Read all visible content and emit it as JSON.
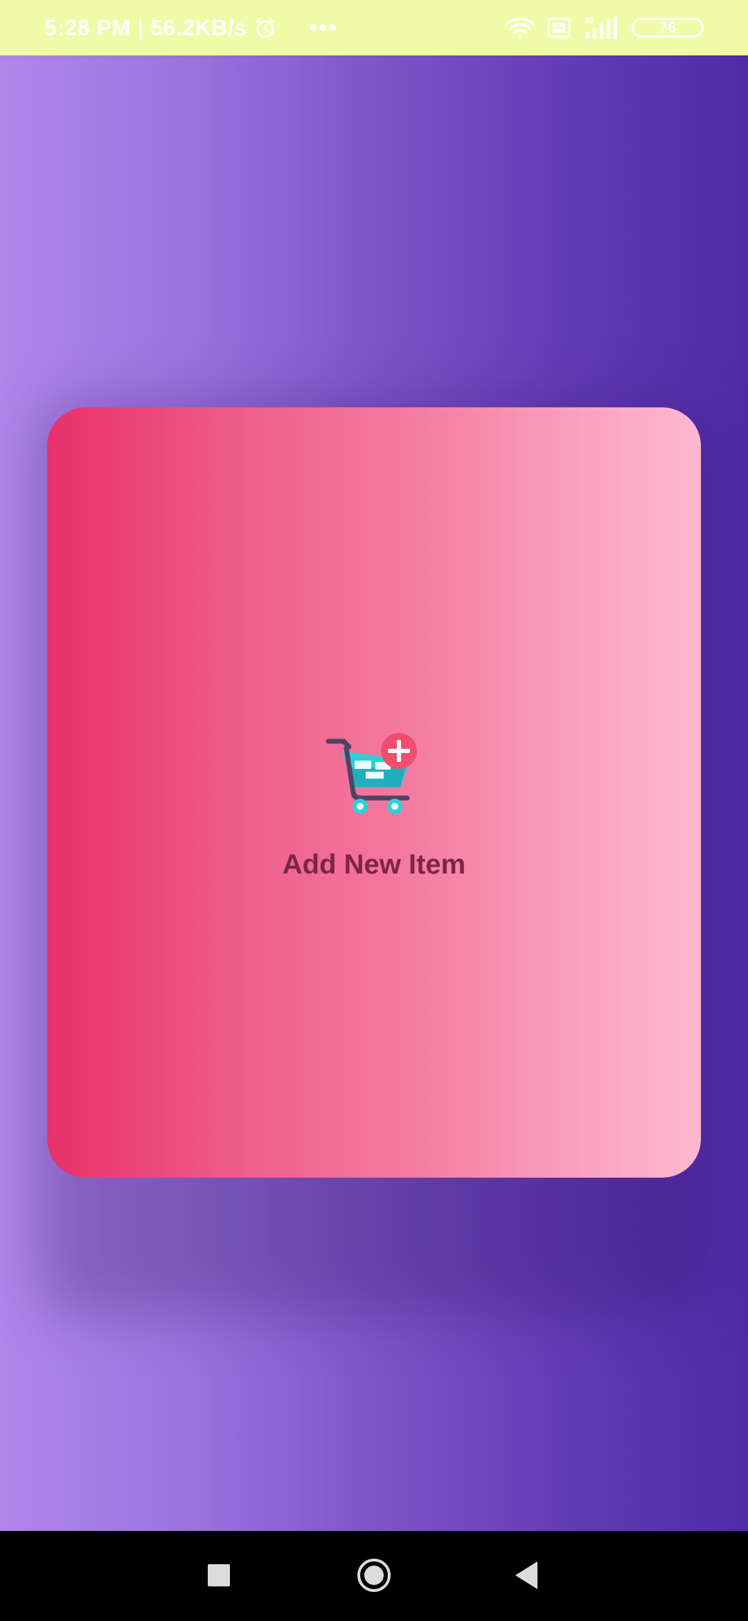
{
  "status_bar": {
    "time": "5:28 PM",
    "separator": "|",
    "speed": "56.2KB/s",
    "dots": "•••",
    "battery": "76",
    "icons": [
      "alarm-icon",
      "wifi-icon",
      "volte-icon",
      "signal-4g-icon",
      "battery-icon"
    ]
  },
  "card": {
    "title": "Add New Item",
    "icon": "add-to-cart-icon",
    "colors": {
      "gradient_start": "#e8306b",
      "gradient_end": "#ffb9d1",
      "title_color": "#7c2546"
    }
  },
  "background": {
    "gradient_start": "#b086ec",
    "gradient_end": "#512aa8"
  },
  "nav_bar": {
    "buttons": [
      "recents-button",
      "home-button",
      "back-button"
    ]
  },
  "colors": {
    "status_bar_bg": "#f0fba8",
    "nav_bar_bg": "#000000"
  }
}
